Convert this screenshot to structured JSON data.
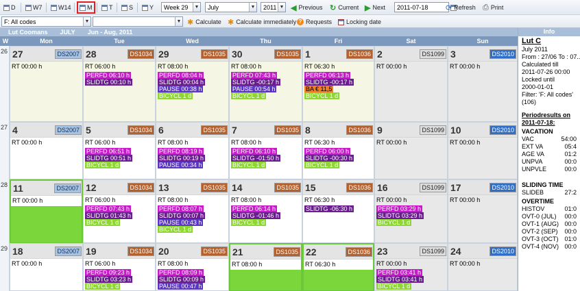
{
  "toolbar": {
    "views": [
      {
        "label": "D"
      },
      {
        "label": "W7"
      },
      {
        "label": "W14"
      },
      {
        "label": "M"
      },
      {
        "label": "T"
      },
      {
        "label": "S"
      },
      {
        "label": "Y"
      }
    ],
    "week_select": "Week 29",
    "month_select": "July",
    "year_select": "2011",
    "previous": "Previous",
    "current": "Current",
    "next": "Next",
    "date_value": "2011-07-18",
    "refresh": "Refresh",
    "print": "Print"
  },
  "toolbar2": {
    "filter_select": "F: All codes",
    "calculate": "Calculate",
    "calculate_immediately": "Calculate immediately",
    "requests": "Requests",
    "locking_date": "Locking date"
  },
  "header": {
    "person": "Lut Coomans",
    "month": "JULY",
    "range": "Jun - Aug, 2011"
  },
  "day_headers": [
    "W",
    "Mon",
    "Tue",
    "Wed",
    "Thu",
    "Fri",
    "Sat",
    "Sun"
  ],
  "colors": {
    "perfd": "#c51bc8",
    "slidtg": "#6a1d8f",
    "pause": "#5b35c4",
    "bicycl": "#8ed632",
    "green_day": "#7bd63c"
  },
  "weeks": [
    {
      "week": "26",
      "days": [
        {
          "num": "27",
          "code": "DS2007",
          "rt": "RT 00:00 h",
          "tags": []
        },
        {
          "num": "28",
          "code": "DS1034",
          "rt": "RT 06:00 h",
          "tags": [
            {
              "t": "perfd",
              "text": "PERFD 06:10 h"
            },
            {
              "t": "slidtg",
              "text": "SLIDTG 00:10 h"
            }
          ]
        },
        {
          "num": "29",
          "code": "DS1035",
          "rt": "RT 08:00 h",
          "tags": [
            {
              "t": "perfd",
              "text": "PERFD 08:04 h"
            },
            {
              "t": "slidtg",
              "text": "SLIDTG 00:04 h"
            },
            {
              "t": "pause",
              "text": "PAUSE 00:38 h"
            },
            {
              "t": "bicycl",
              "text": "BICYCL 1 d"
            }
          ]
        },
        {
          "num": "30",
          "code": "DS1035",
          "rt": "RT 08:00 h",
          "tags": [
            {
              "t": "perfd",
              "text": "PERFD 07:43 h"
            },
            {
              "t": "slidtg",
              "text": "SLIDTG -00:17 h"
            },
            {
              "t": "pause",
              "text": "PAUSE 00:54 h"
            },
            {
              "t": "bicycl",
              "text": "BICYCL 1 d"
            }
          ]
        },
        {
          "num": "1",
          "code": "DS1036",
          "rt": "RT 06:30 h",
          "tags": [
            {
              "t": "perfd",
              "text": "PERFD 06:13 h"
            },
            {
              "t": "slidtg",
              "text": "SLIDTG -00:17 h"
            },
            {
              "t": "ba",
              "text": "BA € 11,5"
            },
            {
              "t": "bicycl",
              "text": "BICYCL 1 d"
            }
          ]
        },
        {
          "num": "2",
          "code": "DS1099",
          "rt": "RT 00:00 h",
          "tags": []
        },
        {
          "num": "3",
          "code": "DS2010",
          "rt": "RT 00:00 h",
          "tags": []
        }
      ]
    },
    {
      "week": "27",
      "days": [
        {
          "num": "4",
          "code": "DS2007",
          "rt": "RT 00:00 h",
          "tags": []
        },
        {
          "num": "5",
          "code": "DS1034",
          "rt": "RT 06:00 h",
          "tags": [
            {
              "t": "perfd",
              "text": "PERFD 06:51 h"
            },
            {
              "t": "slidtg",
              "text": "SLIDTG 00:51 h"
            },
            {
              "t": "bicycl",
              "text": "BICYCL 1 d"
            }
          ]
        },
        {
          "num": "6",
          "code": "DS1035",
          "rt": "RT 08:00 h",
          "tags": [
            {
              "t": "perfd",
              "text": "PERFD 08:19 h"
            },
            {
              "t": "slidtg",
              "text": "SLIDTG 00:19 h"
            },
            {
              "t": "pause",
              "text": "PAUSE 00:34 h"
            }
          ]
        },
        {
          "num": "7",
          "code": "DS1035",
          "rt": "RT 08:00 h",
          "tags": [
            {
              "t": "perfd",
              "text": "PERFD 06:10 h"
            },
            {
              "t": "slidtg",
              "text": "SLIDTG -01:50 h"
            },
            {
              "t": "bicycl",
              "text": "BICYCL 1 d"
            }
          ]
        },
        {
          "num": "8",
          "code": "DS1036",
          "rt": "RT 06:30 h",
          "tags": [
            {
              "t": "perfd",
              "text": "PERFD 06:00 h"
            },
            {
              "t": "slidtg",
              "text": "SLIDTG -00:30 h"
            },
            {
              "t": "bicycl",
              "text": "BICYCL 1 d"
            }
          ]
        },
        {
          "num": "9",
          "code": "DS1099",
          "rt": "RT 00:00 h",
          "tags": []
        },
        {
          "num": "10",
          "code": "DS2010",
          "rt": "RT 00:00 h",
          "tags": []
        }
      ]
    },
    {
      "week": "28",
      "days": [
        {
          "num": "11",
          "code": "DS2007",
          "rt": "RT 00:00 h",
          "tags": []
        },
        {
          "num": "12",
          "code": "DS1034",
          "rt": "RT 06:00 h",
          "tags": [
            {
              "t": "perfd",
              "text": "PERFD 07:43 h"
            },
            {
              "t": "slidtg",
              "text": "SLIDTG 01:43 h"
            },
            {
              "t": "bicycl",
              "text": "BICYCL 1 d"
            }
          ]
        },
        {
          "num": "13",
          "code": "DS1035",
          "rt": "RT 08:00 h",
          "tags": [
            {
              "t": "perfd",
              "text": "PERFD 08:07 h"
            },
            {
              "t": "slidtg",
              "text": "SLIDTG 00:07 h"
            },
            {
              "t": "pause",
              "text": "PAUSE 00:43 h"
            },
            {
              "t": "bicycl",
              "text": "BICYCL 1 d"
            }
          ]
        },
        {
          "num": "14",
          "code": "DS1035",
          "rt": "RT 08:00 h",
          "tags": [
            {
              "t": "perfd",
              "text": "PERFD 06:14 h"
            },
            {
              "t": "slidtg",
              "text": "SLIDTG -01:46 h"
            },
            {
              "t": "bicycl",
              "text": "BICYCL 1 d"
            }
          ]
        },
        {
          "num": "15",
          "code": "DS1036",
          "rt": "RT 06:30 h",
          "tags": [
            {
              "t": "slidtg",
              "text": "SLIDTG -06:30 h"
            }
          ]
        },
        {
          "num": "16",
          "code": "DS1099",
          "rt": "RT 00:00 h",
          "tags": [
            {
              "t": "perfd",
              "text": "PERFD 03:29 h"
            },
            {
              "t": "slidtg",
              "text": "SLIDTG 03:29 h"
            },
            {
              "t": "bicycl",
              "text": "BICYCL 1 d"
            }
          ]
        },
        {
          "num": "17",
          "code": "DS2010",
          "rt": "RT 00:00 h",
          "tags": []
        }
      ]
    },
    {
      "week": "29",
      "days": [
        {
          "num": "18",
          "code": "DS2007",
          "rt": "RT 00:00 h",
          "tags": []
        },
        {
          "num": "19",
          "code": "DS1034",
          "rt": "RT 06:00 h",
          "tags": [
            {
              "t": "perfd",
              "text": "PERFD 09:23 h"
            },
            {
              "t": "slidtg",
              "text": "SLIDTG 03:23 h"
            },
            {
              "t": "bicycl",
              "text": "BICYCL 1 d"
            }
          ]
        },
        {
          "num": "20",
          "code": "DS1035",
          "rt": "RT 08:00 h",
          "tags": [
            {
              "t": "perfd",
              "text": "PERFD 08:09 h"
            },
            {
              "t": "slidtg",
              "text": "SLIDTG 00:09 h"
            },
            {
              "t": "pause",
              "text": "PAUSE 00:47 h"
            }
          ]
        },
        {
          "num": "21",
          "code": "DS1035",
          "rt": "RT 08:00 h",
          "tags": []
        },
        {
          "num": "22",
          "code": "DS1036",
          "rt": "RT 06:30 h",
          "tags": []
        },
        {
          "num": "23",
          "code": "DS1099",
          "rt": "RT 00:00 h",
          "tags": [
            {
              "t": "perfd",
              "text": "PERFD 03:41 h"
            },
            {
              "t": "slidtg",
              "text": "SLIDTG 03:41 h"
            },
            {
              "t": "bicycl",
              "text": "BICYCL 1 d"
            }
          ]
        },
        {
          "num": "24",
          "code": "DS2010",
          "rt": "RT 00:00 h",
          "tags": []
        }
      ]
    }
  ],
  "info": {
    "header": "Info",
    "name": "Lut C",
    "month": "July 2011",
    "from": "From : 27/06 To : 07...",
    "calc_label": "Calculated till",
    "calc_value": "2011-07-26 00:00",
    "locked_label": "Locked until",
    "locked_value": "2000-01-01",
    "filter": "Filter: 'F: All codes'",
    "filter_count": "(106)",
    "period_title": "Periodresults on 2011-07-18:",
    "vacation_title": "VACATION",
    "vacation": [
      {
        "k": "VAC",
        "v": "54:00"
      },
      {
        "k": "EXT VA",
        "v": "05:4"
      },
      {
        "k": "AGE VA",
        "v": "01:2"
      },
      {
        "k": "UNPVA",
        "v": "00:0"
      },
      {
        "k": "UNPVLE",
        "v": "00:0"
      }
    ],
    "sliding_title": "SLIDING TIME",
    "sliding": [
      {
        "k": "SLIDEB",
        "v": "27:2"
      }
    ],
    "overtime_title": "OVERTIME",
    "overtime": [
      {
        "k": "HISTOV",
        "v": "01:0"
      },
      {
        "k": "OVT-0 (JUL)",
        "v": "00:0"
      },
      {
        "k": "OVT-1 (AUG)",
        "v": "00:0"
      },
      {
        "k": "OVT-2 (SEP)",
        "v": "00:0"
      },
      {
        "k": "OVT-3 (OCT)",
        "v": "01:0"
      },
      {
        "k": "OVT-4 (NOV)",
        "v": "00:0"
      }
    ]
  }
}
